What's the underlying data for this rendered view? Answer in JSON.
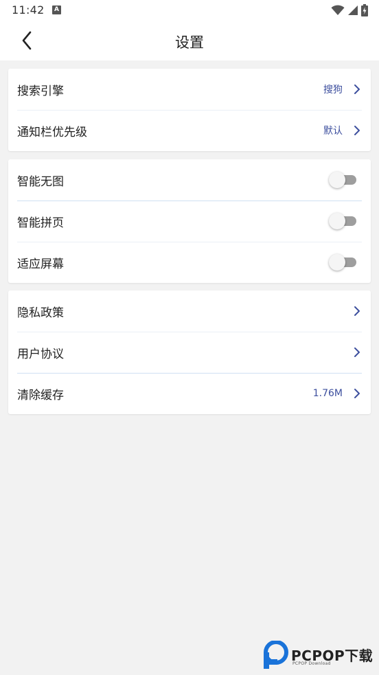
{
  "status_bar": {
    "time": "11:42",
    "notification_icon_letter": "A"
  },
  "header": {
    "title": "设置"
  },
  "groups": [
    {
      "items": [
        {
          "label": "搜索引擎",
          "value": "搜狗"
        },
        {
          "label": "通知栏优先级",
          "value": "默认"
        }
      ]
    },
    {
      "items": [
        {
          "label": "智能无图",
          "toggle_on": false
        },
        {
          "label": "智能拼页",
          "toggle_on": false
        },
        {
          "label": "适应屏幕",
          "toggle_on": false
        }
      ]
    },
    {
      "items": [
        {
          "label": "隐私政策"
        },
        {
          "label": "用户协议"
        },
        {
          "label": "清除缓存",
          "value": "1.76M"
        }
      ]
    }
  ],
  "watermark": {
    "brand": "PCPOP下载",
    "sub": "PCPOP Download"
  },
  "colors": {
    "accent_value": "#3d4f9e",
    "background": "#f2f2f2",
    "card": "#ffffff",
    "watermark_blue": "#1a73d9"
  },
  "icons": {
    "back": "chevron-left-icon",
    "row_arrow": "chevron-right-icon",
    "wifi": "wifi-icon",
    "signal": "signal-icon",
    "battery": "battery-charging-icon"
  }
}
